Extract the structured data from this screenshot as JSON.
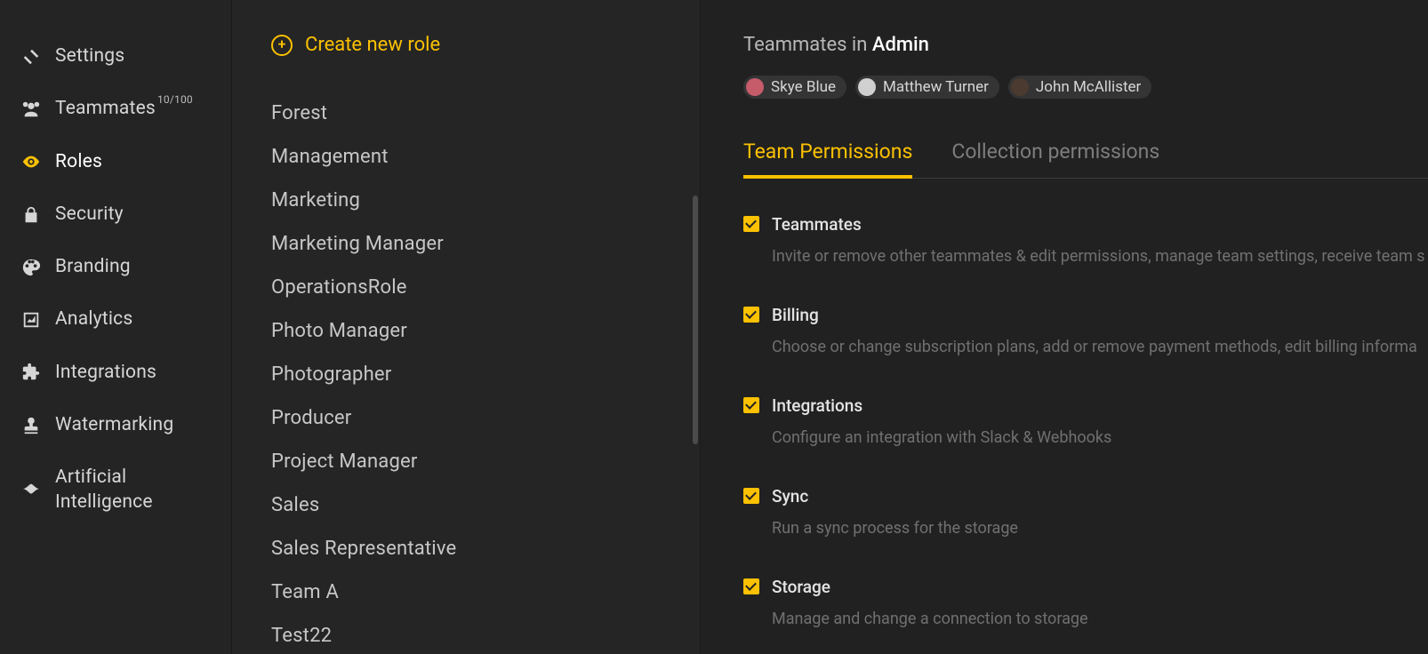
{
  "sidebar": {
    "items": [
      {
        "label": "Settings",
        "icon": "settings-icon"
      },
      {
        "label": "Teammates",
        "icon": "teammates-icon",
        "sup": "10/100"
      },
      {
        "label": "Roles",
        "icon": "roles-icon",
        "active": true
      },
      {
        "label": "Security",
        "icon": "security-icon"
      },
      {
        "label": "Branding",
        "icon": "branding-icon"
      },
      {
        "label": "Analytics",
        "icon": "analytics-icon"
      },
      {
        "label": "Integrations",
        "icon": "integrations-icon"
      },
      {
        "label": "Watermarking",
        "icon": "watermarking-icon"
      },
      {
        "label": "Artificial Intelligence",
        "icon": "ai-icon"
      }
    ]
  },
  "roles": {
    "create_label": "Create new role",
    "list": [
      "Forest",
      "Management",
      "Marketing",
      "Marketing Manager",
      "OperationsRole",
      "Photo Manager",
      "Photographer",
      "Producer",
      "Project Manager",
      "Sales",
      "Sales Representative",
      "Team A",
      "Test22"
    ]
  },
  "main": {
    "title_prefix": "Teammates in ",
    "role_name": "Admin",
    "teammates": [
      {
        "name": "Skye Blue",
        "avatar_bg": "#c65b6a"
      },
      {
        "name": "Matthew Turner",
        "avatar_bg": "#d0d0d0"
      },
      {
        "name": "John McAllister",
        "avatar_bg": "#4a3a30"
      }
    ],
    "tabs": [
      {
        "label": "Team Permissions",
        "active": true
      },
      {
        "label": "Collection permissions",
        "active": false
      }
    ],
    "permissions": [
      {
        "title": "Teammates",
        "desc": "Invite or remove other teammates & edit permissions, manage team settings, receive team s",
        "checked": true
      },
      {
        "title": "Billing",
        "desc": "Choose or change subscription plans, add or remove payment methods, edit billing informa",
        "checked": true
      },
      {
        "title": "Integrations",
        "desc": "Configure an integration with Slack & Webhooks",
        "checked": true
      },
      {
        "title": "Sync",
        "desc": "Run a sync process for the storage",
        "checked": true
      },
      {
        "title": "Storage",
        "desc": "Manage and change a connection to storage",
        "checked": true
      }
    ]
  }
}
